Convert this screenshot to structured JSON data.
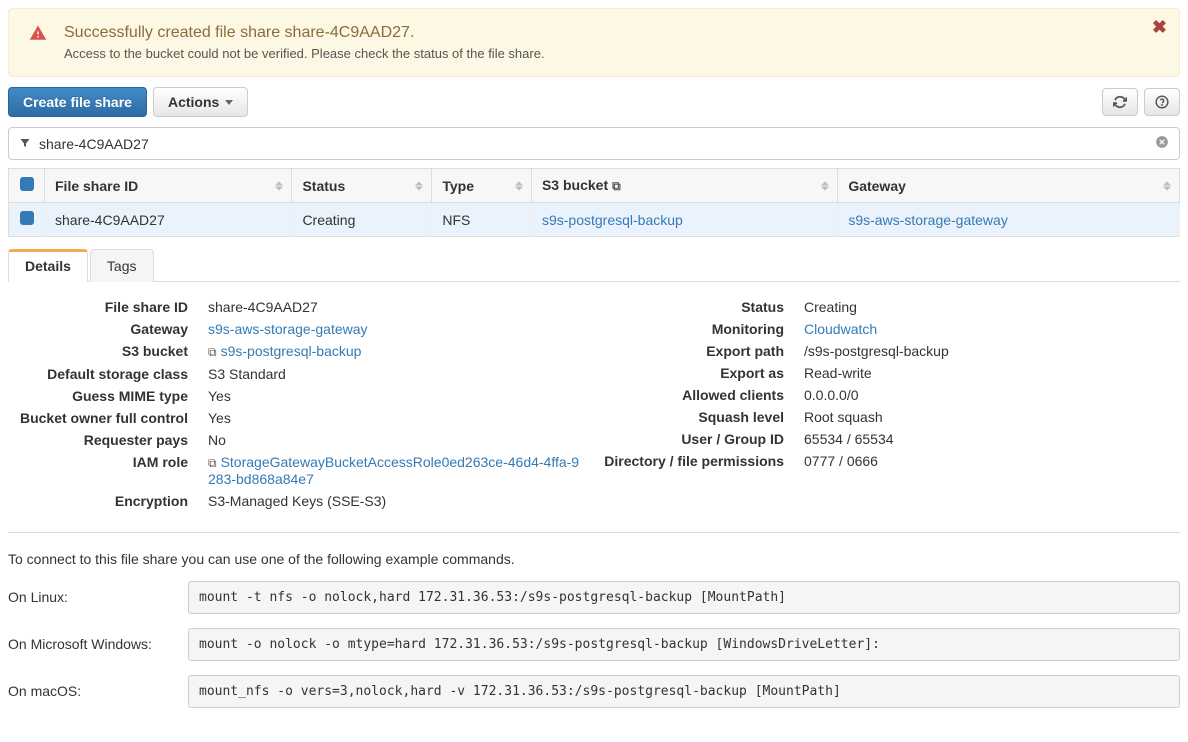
{
  "alert": {
    "title": "Successfully created file share share-4C9AAD27.",
    "text": "Access to the bucket could not be verified. Please check the status of the file share."
  },
  "toolbar": {
    "create_label": "Create file share",
    "actions_label": "Actions"
  },
  "filter": {
    "value": "share-4C9AAD27"
  },
  "columns": {
    "id": "File share ID",
    "status": "Status",
    "type": "Type",
    "bucket": "S3 bucket",
    "gateway": "Gateway"
  },
  "row": {
    "id": "share-4C9AAD27",
    "status": "Creating",
    "type": "NFS",
    "bucket": "s9s-postgresql-backup",
    "gateway": "s9s-aws-storage-gateway"
  },
  "tabs": {
    "details": "Details",
    "tags": "Tags"
  },
  "labels": {
    "file_share_id": "File share ID",
    "gateway": "Gateway",
    "s3_bucket": "S3 bucket",
    "default_storage_class": "Default storage class",
    "guess_mime": "Guess MIME type",
    "bucket_owner_full_control": "Bucket owner full control",
    "requester_pays": "Requester pays",
    "iam_role": "IAM role",
    "encryption": "Encryption",
    "status": "Status",
    "monitoring": "Monitoring",
    "export_path": "Export path",
    "export_as": "Export as",
    "allowed_clients": "Allowed clients",
    "squash_level": "Squash level",
    "user_group_id": "User / Group ID",
    "dir_file_perms": "Directory / file permissions"
  },
  "details": {
    "file_share_id": "share-4C9AAD27",
    "gateway": "s9s-aws-storage-gateway",
    "s3_bucket": "s9s-postgresql-backup",
    "default_storage_class": "S3 Standard",
    "guess_mime": "Yes",
    "bucket_owner_full_control": "Yes",
    "requester_pays": "No",
    "iam_role": "StorageGatewayBucketAccessRole0ed263ce-46d4-4ffa-9283-bd868a84e7",
    "encryption": "S3-Managed Keys (SSE-S3)",
    "status": "Creating",
    "monitoring": "Cloudwatch",
    "export_path": "/s9s-postgresql-backup",
    "export_as": "Read-write",
    "allowed_clients": "0.0.0.0/0",
    "squash_level": "Root squash",
    "user_group_id": "65534 / 65534",
    "dir_file_perms": "0777 / 0666"
  },
  "connect": {
    "intro": "To connect to this file share you can use one of the following example commands.",
    "linux_label": "On Linux:",
    "windows_label": "On Microsoft Windows:",
    "macos_label": "On macOS:",
    "linux_cmd": "mount -t nfs -o nolock,hard 172.31.36.53:/s9s-postgresql-backup [MountPath]",
    "windows_cmd": "mount -o nolock -o mtype=hard 172.31.36.53:/s9s-postgresql-backup [WindowsDriveLetter]:",
    "macos_cmd": "mount_nfs -o vers=3,nolock,hard -v 172.31.36.53:/s9s-postgresql-backup [MountPath]"
  }
}
